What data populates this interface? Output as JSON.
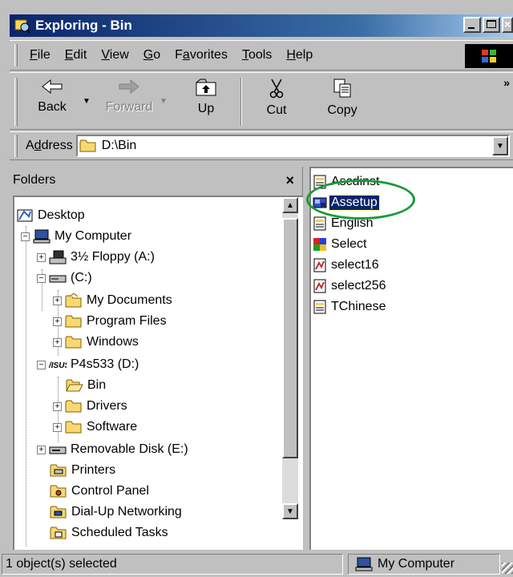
{
  "window": {
    "title": "Exploring - Bin"
  },
  "menu": {
    "items": [
      {
        "pre": "",
        "key": "F",
        "post": "ile"
      },
      {
        "pre": "",
        "key": "E",
        "post": "dit"
      },
      {
        "pre": "",
        "key": "V",
        "post": "iew"
      },
      {
        "pre": "",
        "key": "G",
        "post": "o"
      },
      {
        "pre": "F",
        "key": "a",
        "post": "vorites"
      },
      {
        "pre": "",
        "key": "T",
        "post": "ools"
      },
      {
        "pre": "",
        "key": "H",
        "post": "elp"
      }
    ]
  },
  "toolbar": {
    "back": "Back",
    "forward": "Forward",
    "up": "Up",
    "cut": "Cut",
    "copy": "Copy",
    "more": "»"
  },
  "address": {
    "pre": "A",
    "key": "d",
    "post": "dress",
    "value": "D:\\Bin"
  },
  "folders": {
    "header": "Folders",
    "close": "×",
    "tree": [
      {
        "label": "Desktop",
        "icon": "desktop-icon",
        "expander": ""
      },
      {
        "label": "My Computer",
        "icon": "computer-icon",
        "expander": "−"
      },
      {
        "label": "3½ Floppy (A:)",
        "icon": "floppy-drive-icon",
        "expander": "+"
      },
      {
        "label": "(C:)",
        "icon": "hard-drive-icon",
        "expander": "−"
      },
      {
        "label": "My Documents",
        "icon": "my-documents-folder-icon",
        "expander": "+"
      },
      {
        "label": "Program Files",
        "icon": "folder-icon",
        "expander": "+"
      },
      {
        "label": "Windows",
        "icon": "folder-icon",
        "expander": "+"
      },
      {
        "label": "P4s533 (D:)",
        "icon": "asus-drive-icon",
        "expander": "−"
      },
      {
        "label": "Bin",
        "icon": "open-folder-icon",
        "expander": ""
      },
      {
        "label": "Drivers",
        "icon": "folder-icon",
        "expander": "+"
      },
      {
        "label": "Software",
        "icon": "folder-icon",
        "expander": "+"
      },
      {
        "label": "Removable Disk (E:)",
        "icon": "removable-disk-icon",
        "expander": "+"
      },
      {
        "label": "Printers",
        "icon": "printers-icon",
        "expander": ""
      },
      {
        "label": "Control Panel",
        "icon": "control-panel-icon",
        "expander": ""
      },
      {
        "label": "Dial-Up Networking",
        "icon": "dialup-networking-icon",
        "expander": ""
      },
      {
        "label": "Scheduled Tasks",
        "icon": "scheduled-tasks-icon",
        "expander": ""
      }
    ]
  },
  "files": [
    {
      "label": "Ascdinst",
      "icon": "config-file-icon"
    },
    {
      "label": "Assetup",
      "icon": "setup-app-icon",
      "selected": true
    },
    {
      "label": "English",
      "icon": "config-file-icon"
    },
    {
      "label": "Select",
      "icon": "asus-app-icon"
    },
    {
      "label": "select16",
      "icon": "select-image-icon"
    },
    {
      "label": "select256",
      "icon": "select-image-icon"
    },
    {
      "label": "TChinese",
      "icon": "config-file-icon"
    }
  ],
  "status": {
    "selected": "1 object(s) selected",
    "location": "My Computer"
  },
  "colors": {
    "title_start": "#0a246a",
    "title_end": "#a6caf0",
    "selection": "#0a246a",
    "annotation_circle": "#1a9a3a"
  }
}
